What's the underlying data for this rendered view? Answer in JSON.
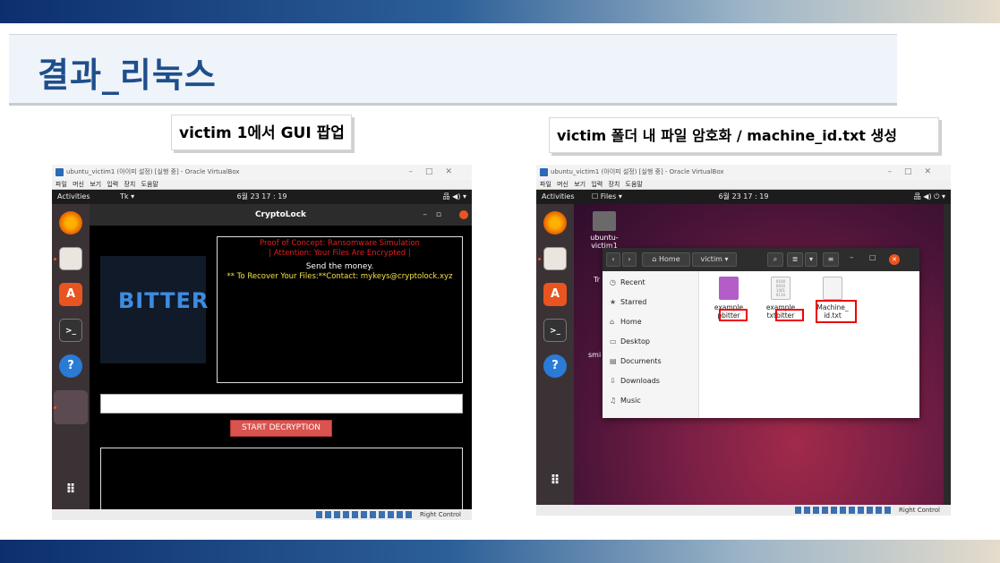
{
  "slide": {
    "title": "결과_리눅스",
    "caption_left": "victim 1에서 GUI 팝업",
    "caption_right": "victim 폴더 내 파일 암호화 / machine_id.txt 생성"
  },
  "vm1": {
    "window_title": "ubuntu_victim1 (아이피 설정) [실행 중] - Oracle VirtualBox",
    "menu": "파일 머신 보기 입력 장치 도움말",
    "activities": "Activities",
    "app_menu": "Tk ▾",
    "clock": "6월 23  17 : 19",
    "tray": "品 ◀) ▾",
    "status_right": "Right Control",
    "cryptolock": {
      "title": "CryptoLock",
      "logo": "BITTER",
      "line1": "Proof of Concept: Ransomware Simulation",
      "line2": "| Attention: Your Files Are Encrypted |",
      "line3": "Send the money.",
      "line4": "** To Recover Your Files:**Contact: mykeys@cryptolock.xyz",
      "button": "START DECRYPTION"
    }
  },
  "vm2": {
    "window_title": "ubuntu_victim1 (아이피 설정) [실행 중] - Oracle VirtualBox",
    "menu": "파일 머신 보기 입력 장치 도움말",
    "activities": "Activities",
    "app_menu": "☐ Files ▾",
    "clock": "6월 23  17 : 19",
    "tray": "品 ◀) ⏻ ▾",
    "status_right": "Right Control",
    "desktop_home": "ubuntu-victim1",
    "desktop_tr": "Tr",
    "desktop_smi": "smi",
    "files": {
      "crumb_home": "Home",
      "crumb_folder": "victim",
      "sidebar": [
        {
          "icon": "◷",
          "label": "Recent"
        },
        {
          "icon": "★",
          "label": "Starred"
        },
        {
          "icon": "⌂",
          "label": "Home"
        },
        {
          "icon": "▭",
          "label": "Desktop"
        },
        {
          "icon": "▤",
          "label": "Documents"
        },
        {
          "icon": "⇩",
          "label": "Downloads"
        },
        {
          "icon": "♫",
          "label": "Music"
        }
      ],
      "items": [
        {
          "line1": "example",
          "line2a": "p",
          "line2b": "bitter"
        },
        {
          "line1": "example",
          "line2a": "txt",
          "line2b": "bitter"
        },
        {
          "line1": "Machine_",
          "line2a": "",
          "line2b": "id.txt"
        }
      ],
      "thumb_text": "0100\n0010\n1001\n0110"
    }
  }
}
